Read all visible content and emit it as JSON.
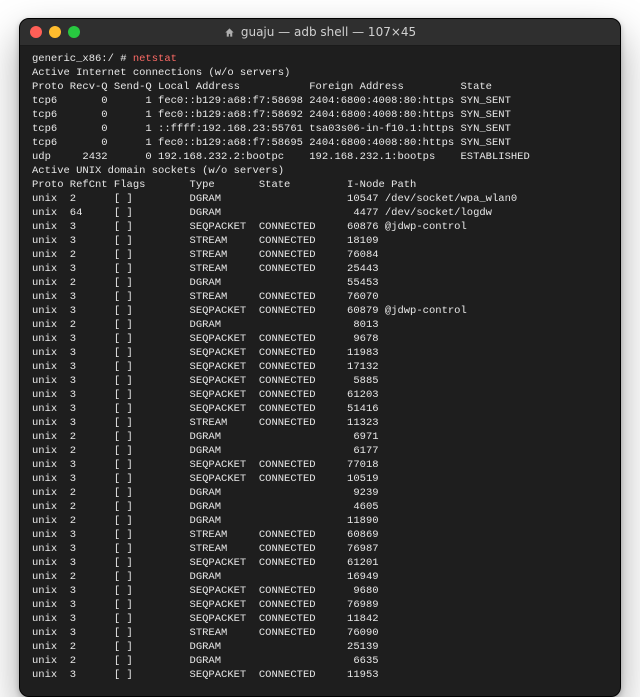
{
  "window": {
    "title": "guaju — adb shell — 107×45"
  },
  "prompt": {
    "device": "generic_x86:/ # ",
    "command": "netstat"
  },
  "sections": {
    "inet_header": "Active Internet connections (w/o servers)",
    "inet_cols": "Proto Recv-Q Send-Q Local Address           Foreign Address         State",
    "unix_header": "Active UNIX domain sockets (w/o servers)",
    "unix_cols": "Proto RefCnt Flags       Type       State         I-Node Path"
  },
  "inet_rows": [
    {
      "proto": "tcp6",
      "recv": "0",
      "send": "1",
      "local": "fec0::b129:a68:f7:58698",
      "foreign": "2404:6800:4008:80:https",
      "state": "SYN_SENT"
    },
    {
      "proto": "tcp6",
      "recv": "0",
      "send": "1",
      "local": "fec0::b129:a68:f7:58692",
      "foreign": "2404:6800:4008:80:https",
      "state": "SYN_SENT"
    },
    {
      "proto": "tcp6",
      "recv": "0",
      "send": "1",
      "local": "::ffff:192.168.23:55761",
      "foreign": "tsa03s06-in-f10.1:https",
      "state": "SYN_SENT"
    },
    {
      "proto": "tcp6",
      "recv": "0",
      "send": "1",
      "local": "fec0::b129:a68:f7:58695",
      "foreign": "2404:6800:4008:80:https",
      "state": "SYN_SENT"
    },
    {
      "proto": "udp",
      "recv": "2432",
      "send": "0",
      "local": "192.168.232.2:bootpc",
      "foreign": "192.168.232.1:bootps",
      "state": "ESTABLISHED"
    }
  ],
  "unix_rows": [
    {
      "proto": "unix",
      "ref": "2",
      "flags": "[ ]",
      "type": "DGRAM",
      "state": "",
      "inode": "10547",
      "path": "/dev/socket/wpa_wlan0"
    },
    {
      "proto": "unix",
      "ref": "64",
      "flags": "[ ]",
      "type": "DGRAM",
      "state": "",
      "inode": "4477",
      "path": "/dev/socket/logdw"
    },
    {
      "proto": "unix",
      "ref": "3",
      "flags": "[ ]",
      "type": "SEQPACKET",
      "state": "CONNECTED",
      "inode": "60876",
      "path": "@jdwp-control"
    },
    {
      "proto": "unix",
      "ref": "3",
      "flags": "[ ]",
      "type": "STREAM",
      "state": "CONNECTED",
      "inode": "18109",
      "path": ""
    },
    {
      "proto": "unix",
      "ref": "2",
      "flags": "[ ]",
      "type": "STREAM",
      "state": "CONNECTED",
      "inode": "76084",
      "path": ""
    },
    {
      "proto": "unix",
      "ref": "3",
      "flags": "[ ]",
      "type": "STREAM",
      "state": "CONNECTED",
      "inode": "25443",
      "path": ""
    },
    {
      "proto": "unix",
      "ref": "2",
      "flags": "[ ]",
      "type": "DGRAM",
      "state": "",
      "inode": "55453",
      "path": ""
    },
    {
      "proto": "unix",
      "ref": "3",
      "flags": "[ ]",
      "type": "STREAM",
      "state": "CONNECTED",
      "inode": "76070",
      "path": ""
    },
    {
      "proto": "unix",
      "ref": "3",
      "flags": "[ ]",
      "type": "SEQPACKET",
      "state": "CONNECTED",
      "inode": "60879",
      "path": "@jdwp-control"
    },
    {
      "proto": "unix",
      "ref": "2",
      "flags": "[ ]",
      "type": "DGRAM",
      "state": "",
      "inode": "8013",
      "path": ""
    },
    {
      "proto": "unix",
      "ref": "3",
      "flags": "[ ]",
      "type": "SEQPACKET",
      "state": "CONNECTED",
      "inode": "9678",
      "path": ""
    },
    {
      "proto": "unix",
      "ref": "3",
      "flags": "[ ]",
      "type": "SEQPACKET",
      "state": "CONNECTED",
      "inode": "11983",
      "path": ""
    },
    {
      "proto": "unix",
      "ref": "3",
      "flags": "[ ]",
      "type": "SEQPACKET",
      "state": "CONNECTED",
      "inode": "17132",
      "path": ""
    },
    {
      "proto": "unix",
      "ref": "3",
      "flags": "[ ]",
      "type": "SEQPACKET",
      "state": "CONNECTED",
      "inode": "5885",
      "path": ""
    },
    {
      "proto": "unix",
      "ref": "3",
      "flags": "[ ]",
      "type": "SEQPACKET",
      "state": "CONNECTED",
      "inode": "61203",
      "path": ""
    },
    {
      "proto": "unix",
      "ref": "3",
      "flags": "[ ]",
      "type": "SEQPACKET",
      "state": "CONNECTED",
      "inode": "51416",
      "path": ""
    },
    {
      "proto": "unix",
      "ref": "3",
      "flags": "[ ]",
      "type": "STREAM",
      "state": "CONNECTED",
      "inode": "11323",
      "path": ""
    },
    {
      "proto": "unix",
      "ref": "2",
      "flags": "[ ]",
      "type": "DGRAM",
      "state": "",
      "inode": "6971",
      "path": ""
    },
    {
      "proto": "unix",
      "ref": "2",
      "flags": "[ ]",
      "type": "DGRAM",
      "state": "",
      "inode": "6177",
      "path": ""
    },
    {
      "proto": "unix",
      "ref": "3",
      "flags": "[ ]",
      "type": "SEQPACKET",
      "state": "CONNECTED",
      "inode": "77018",
      "path": ""
    },
    {
      "proto": "unix",
      "ref": "3",
      "flags": "[ ]",
      "type": "SEQPACKET",
      "state": "CONNECTED",
      "inode": "10519",
      "path": ""
    },
    {
      "proto": "unix",
      "ref": "2",
      "flags": "[ ]",
      "type": "DGRAM",
      "state": "",
      "inode": "9239",
      "path": ""
    },
    {
      "proto": "unix",
      "ref": "2",
      "flags": "[ ]",
      "type": "DGRAM",
      "state": "",
      "inode": "4605",
      "path": ""
    },
    {
      "proto": "unix",
      "ref": "2",
      "flags": "[ ]",
      "type": "DGRAM",
      "state": "",
      "inode": "11890",
      "path": ""
    },
    {
      "proto": "unix",
      "ref": "3",
      "flags": "[ ]",
      "type": "STREAM",
      "state": "CONNECTED",
      "inode": "60869",
      "path": ""
    },
    {
      "proto": "unix",
      "ref": "3",
      "flags": "[ ]",
      "type": "STREAM",
      "state": "CONNECTED",
      "inode": "76987",
      "path": ""
    },
    {
      "proto": "unix",
      "ref": "3",
      "flags": "[ ]",
      "type": "SEQPACKET",
      "state": "CONNECTED",
      "inode": "61201",
      "path": ""
    },
    {
      "proto": "unix",
      "ref": "2",
      "flags": "[ ]",
      "type": "DGRAM",
      "state": "",
      "inode": "16949",
      "path": ""
    },
    {
      "proto": "unix",
      "ref": "3",
      "flags": "[ ]",
      "type": "SEQPACKET",
      "state": "CONNECTED",
      "inode": "9680",
      "path": ""
    },
    {
      "proto": "unix",
      "ref": "3",
      "flags": "[ ]",
      "type": "SEQPACKET",
      "state": "CONNECTED",
      "inode": "76989",
      "path": ""
    },
    {
      "proto": "unix",
      "ref": "3",
      "flags": "[ ]",
      "type": "SEQPACKET",
      "state": "CONNECTED",
      "inode": "11842",
      "path": ""
    },
    {
      "proto": "unix",
      "ref": "3",
      "flags": "[ ]",
      "type": "STREAM",
      "state": "CONNECTED",
      "inode": "76090",
      "path": ""
    },
    {
      "proto": "unix",
      "ref": "2",
      "flags": "[ ]",
      "type": "DGRAM",
      "state": "",
      "inode": "25139",
      "path": ""
    },
    {
      "proto": "unix",
      "ref": "2",
      "flags": "[ ]",
      "type": "DGRAM",
      "state": "",
      "inode": "6635",
      "path": ""
    },
    {
      "proto": "unix",
      "ref": "3",
      "flags": "[ ]",
      "type": "SEQPACKET",
      "state": "CONNECTED",
      "inode": "11953",
      "path": ""
    }
  ]
}
